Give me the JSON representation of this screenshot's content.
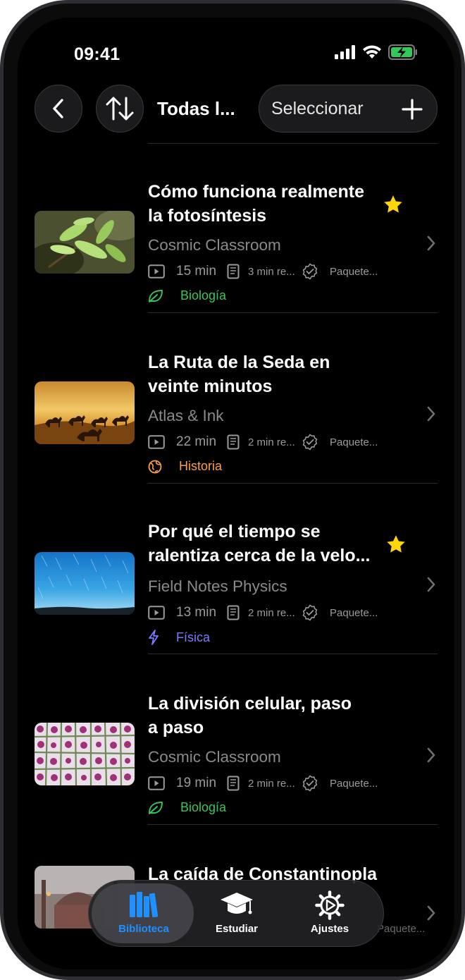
{
  "status_bar": {
    "time": "09:41"
  },
  "header": {
    "title": "Todas l...",
    "select_label": "Seleccionar"
  },
  "videos": [
    {
      "title_lines": [
        "Cómo funciona realmente",
        "la fotosíntesis"
      ],
      "channel": "Cosmic Classroom",
      "duration": "15 min",
      "reading": "3 min re...",
      "package": "Paquete...",
      "tag": "Biología",
      "tag_icon": "leaf-icon",
      "tag_color": "#34c759",
      "favorite": true,
      "thumbnail": "plant-leaves"
    },
    {
      "title_lines": [
        "La Ruta de la Seda en",
        "veinte minutos"
      ],
      "channel": "Atlas & Ink",
      "duration": "22 min",
      "reading": "2 min re...",
      "package": "Paquete...",
      "tag": "Historia",
      "tag_icon": "globe-icon",
      "tag_color": "#ff9f43",
      "favorite": false,
      "thumbnail": "desert-camels"
    },
    {
      "title_lines": [
        "Por qué el tiempo se",
        "ralentiza cerca de la velo..."
      ],
      "channel": "Field Notes Physics",
      "duration": "13 min",
      "reading": "2 min re...",
      "package": "Paquete...",
      "tag": "Física",
      "tag_icon": "bolt-icon",
      "tag_color": "#7a7cff",
      "favorite": true,
      "thumbnail": "star-trails"
    },
    {
      "title_lines": [
        "La división celular, paso",
        "a paso"
      ],
      "channel": "Cosmic Classroom",
      "duration": "19 min",
      "reading": "2 min re...",
      "package": "Paquete...",
      "tag": "Biología",
      "tag_icon": "leaf-icon",
      "tag_color": "#34c759",
      "favorite": false,
      "thumbnail": "cells-micrograph"
    },
    {
      "title_lines": [
        "La caída de Constantinopla"
      ],
      "package": "Paquete...",
      "favorite": false,
      "thumbnail": "hagia-sophia"
    }
  ],
  "tab_bar": {
    "tabs": [
      {
        "label": "Biblioteca",
        "icon": "books-icon",
        "active": true,
        "color": "#1e90ff"
      },
      {
        "label": "Estudiar",
        "icon": "graduation-cap-icon",
        "active": false
      },
      {
        "label": "Ajustes",
        "icon": "gear-icon",
        "active": false
      }
    ]
  },
  "colors": {
    "favorite_star": "#ffd60a",
    "active_tab": "#1e90ff"
  }
}
